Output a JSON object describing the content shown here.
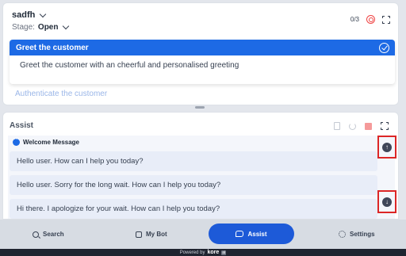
{
  "conversation": {
    "name": "sadfh",
    "stage_label": "Stage:",
    "stage_value": "Open",
    "counter": "0/3"
  },
  "steps": {
    "active": {
      "title": "Greet the customer",
      "description": "Greet the customer with an cheerful and personalised greeting"
    },
    "next": {
      "title": "Authenticate the customer"
    }
  },
  "assist": {
    "title": "Assist",
    "group_title": "Welcome Message",
    "messages": [
      "Hello user. How can I help you today?",
      "Hello user. Sorry for the long wait. How can I help you today?",
      "Hi there. I apologize for your wait. How can I help you today?"
    ],
    "scroll_up_glyph": "↑",
    "scroll_down_glyph": "↓"
  },
  "nav": {
    "search": "Search",
    "mybot": "My Bot",
    "assist": "Assist",
    "settings": "Settings"
  },
  "footer": {
    "powered_by": "Powered by",
    "brand": "kore",
    "badge": "ai"
  },
  "colors": {
    "primary": "#1d6ae5",
    "nav_active": "#1d5ad8",
    "highlight_border": "#dc2626",
    "target_icon": "#ef4444"
  },
  "icons": [
    "chevron-down-icon",
    "target-icon",
    "expand-icon",
    "check-circle-icon",
    "document-icon",
    "refresh-icon",
    "stop-icon",
    "chat-bubble-icon",
    "arrow-up-icon",
    "arrow-down-icon",
    "search-icon",
    "bot-icon",
    "assist-icon",
    "gear-icon"
  ]
}
